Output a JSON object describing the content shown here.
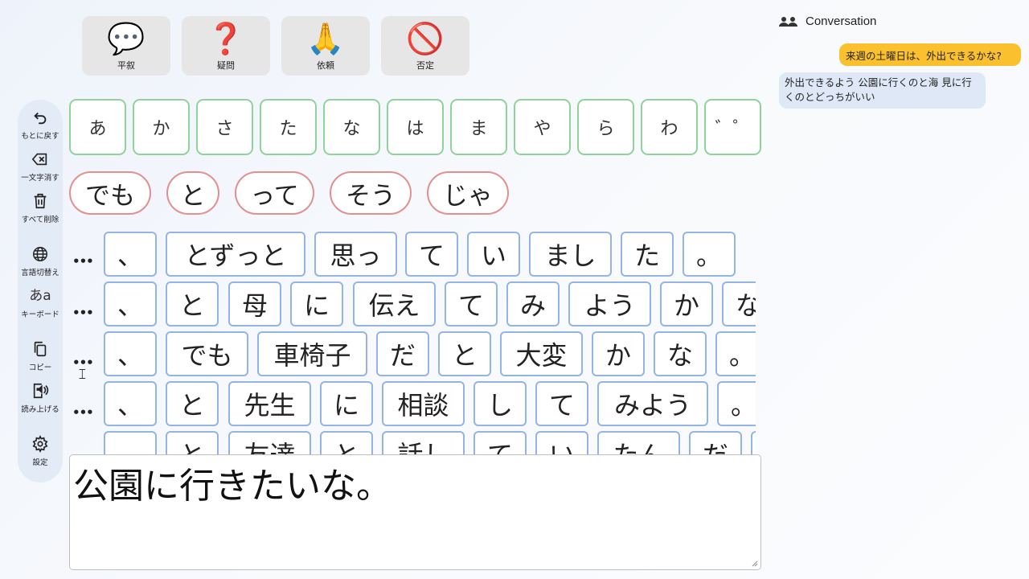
{
  "intents": [
    {
      "emoji": "💬",
      "label": "平叙",
      "icon": "speech-bubble-icon"
    },
    {
      "emoji": "❓",
      "label": "疑問",
      "icon": "question-mark-icon"
    },
    {
      "emoji": "🙏",
      "label": "依頼",
      "icon": "folded-hands-icon"
    },
    {
      "emoji": "🚫",
      "label": "否定",
      "icon": "prohibited-icon"
    }
  ],
  "sidebar": {
    "undo": "もとに戻す",
    "backspace": "一文字消す",
    "delete_all": "すべて削除",
    "language": "言語切替え",
    "keyboard_glyph": "あa",
    "keyboard": "キーボード",
    "copy": "コピー",
    "read_aloud": "読み上げる",
    "settings": "設定"
  },
  "kana_keys": [
    "あ",
    "か",
    "さ",
    "た",
    "な",
    "は",
    "ま",
    "や",
    "ら",
    "わ",
    "゛゜"
  ],
  "connectives": [
    "でも",
    "と",
    "って",
    "そう",
    "じゃ"
  ],
  "more_glyph": "•••",
  "predictions": [
    [
      "、",
      "とずっと",
      "思っ",
      "て",
      "い",
      "まし",
      "た",
      "。"
    ],
    [
      "、",
      "と",
      "母",
      "に",
      "伝え",
      "て",
      "み",
      "よう",
      "か",
      "な"
    ],
    [
      "、",
      "でも",
      "車椅子",
      "だ",
      "と",
      "大変",
      "か",
      "な",
      "。"
    ],
    [
      "、",
      "と",
      "先生",
      "に",
      "相談",
      "し",
      "て",
      "みよう",
      "。"
    ],
    [
      "、",
      "と",
      "友達",
      "と",
      "話し",
      "て",
      "い",
      "たん",
      "だ",
      "。"
    ]
  ],
  "text_input": "公園に行きたいな。",
  "conversation": {
    "title": "Conversation",
    "messages": [
      {
        "from": "partner",
        "text": "来週の土曜日は、外出できるかな?"
      },
      {
        "from": "user",
        "text": "外出できるよう 公園に行くのと海 見に行くのとどっちがいい"
      }
    ]
  }
}
